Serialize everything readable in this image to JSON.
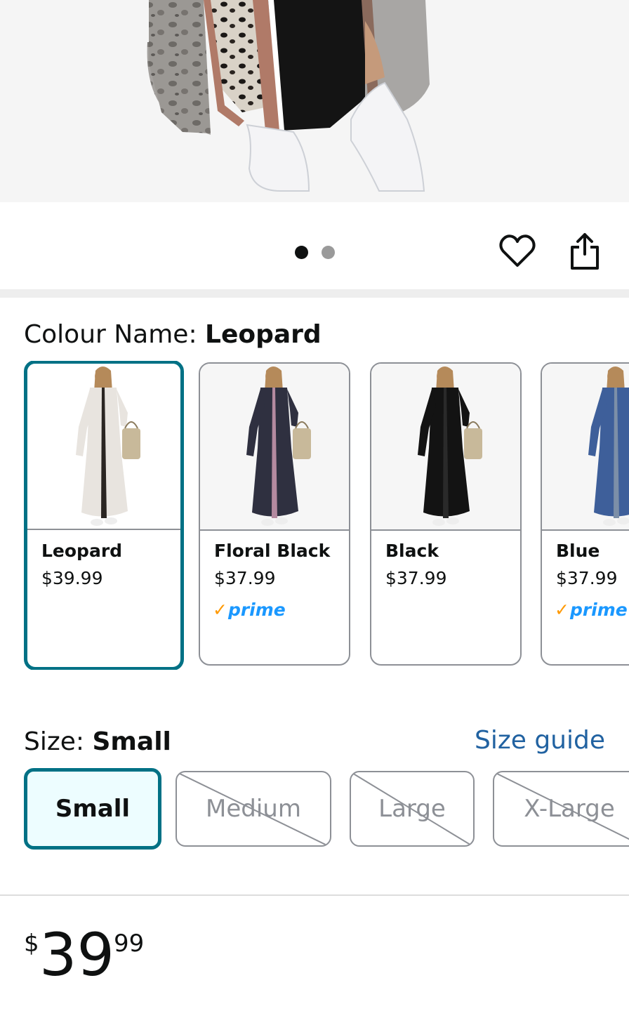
{
  "carousel": {
    "total_images": 2,
    "active_index": 0
  },
  "actions": {
    "wishlist_icon": "heart-icon",
    "share_icon": "share-icon"
  },
  "colour": {
    "label": "Colour Name: ",
    "selected": "Leopard",
    "options": [
      {
        "name": "Leopard",
        "price": "$39.99",
        "prime": false,
        "selected": true,
        "dress_color": "#e8e4df",
        "pattern_color": "#2a2522"
      },
      {
        "name": "Floral Black",
        "price": "$37.99",
        "prime": true,
        "selected": false,
        "dress_color": "#2f3040",
        "pattern_color": "#b48aa0"
      },
      {
        "name": "Black",
        "price": "$37.99",
        "prime": false,
        "selected": false,
        "dress_color": "#131313",
        "pattern_color": "#2a2a2a"
      },
      {
        "name": "Blue",
        "price": "$37.99",
        "prime": true,
        "selected": false,
        "dress_color": "#3e5f9a",
        "pattern_color": "#7c8fa8"
      }
    ],
    "prime_label": "prime"
  },
  "size": {
    "label": "Size: ",
    "selected": "Small",
    "guide_link": "Size guide",
    "options": [
      {
        "label": "Small",
        "available": true,
        "selected": true
      },
      {
        "label": "Medium",
        "available": false,
        "selected": false
      },
      {
        "label": "Large",
        "available": false,
        "selected": false
      },
      {
        "label": "X-Large",
        "available": false,
        "selected": false
      }
    ]
  },
  "price": {
    "currency": "$",
    "whole": "39",
    "fraction": "99"
  },
  "colors": {
    "accent": "#007185",
    "link": "#2162a1",
    "prime_blue": "#1a98ff",
    "prime_check": "#ff9900"
  }
}
